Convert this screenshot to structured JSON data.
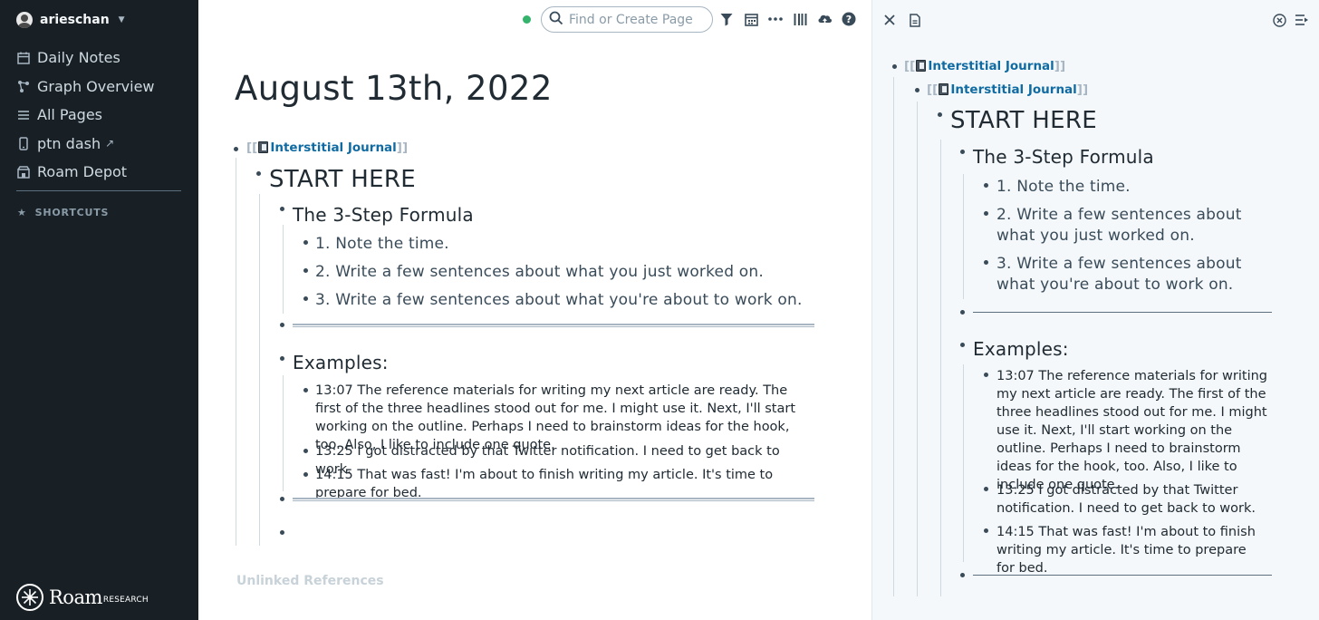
{
  "sidebar": {
    "user": "arieschan",
    "nav": [
      {
        "icon": "calendar-icon",
        "label": "Daily Notes"
      },
      {
        "icon": "graph-icon",
        "label": "Graph Overview"
      },
      {
        "icon": "list-icon",
        "label": "All Pages"
      },
      {
        "icon": "mobile-icon",
        "label": "ptn dash"
      },
      {
        "icon": "store-icon",
        "label": "Roam Depot"
      }
    ],
    "shortcuts_label": "SHORTCUTS",
    "logo_word": "Roam",
    "logo_sub": "RESEARCH"
  },
  "topbar": {
    "search_placeholder": "Find or Create Page",
    "icons": [
      "filter-icon",
      "calendar-icon",
      "more-icon",
      "sidebar-toggle-icon",
      "sync-cloud-icon",
      "help-icon"
    ]
  },
  "page": {
    "title": "August 13th, 2022",
    "ref_open": "[[",
    "ref_label": "Interstitial Journal",
    "ref_close": "]]",
    "start_here": "START HERE",
    "formula_heading": "The 3-Step Formula",
    "steps": [
      "1. Note the time.",
      "2. Write a few sentences about what you just worked on.",
      "3. Write a few sentences about what you're about to work on."
    ],
    "examples_heading": "Examples:",
    "examples": [
      "13:07 The reference materials for writing my next article are ready. The first of the three headlines stood out for me. I might use it. Next, I'll start working on the outline. Perhaps I need to brainstorm ideas for the hook, too. Also, I like to include one quote.",
      "13:25 I got distracted by that Twitter notification. I need to get back to work.",
      "14:15 That was fast! I'm about to finish writing my article. It's time to prepare for bed."
    ],
    "unlinked_refs": "Unlinked References"
  },
  "right_panel": {
    "icons": [
      "close-icon",
      "page-icon",
      "close-all-icon",
      "collapse-panel-icon"
    ],
    "ref_open": "[[",
    "ref_label": "Interstitial Journal",
    "ref_close": "]]",
    "start_here": "START HERE",
    "formula_heading": "The 3-Step Formula",
    "steps": [
      "1. Note the time.",
      "2. Write a few sentences about what you just worked on.",
      "3. Write a few sentences about what you're about to work on."
    ],
    "examples_heading": "Examples:",
    "examples": [
      "13:07 The reference materials for writing my next article are ready. The first of the three headlines stood out for me. I might use it. Next, I'll start working on the outline. Perhaps I need to brainstorm ideas for the hook, too. Also, I like to include one quote.",
      "13:25 I got distracted by that Twitter notification. I need to get back to work.",
      "14:15 That was fast! I'm about to finish writing my article. It's time to prepare for bed."
    ]
  },
  "colors": {
    "sidebar_bg": "#182026",
    "link": "#106ba3",
    "sync_dot": "#33b36b",
    "panel_bg": "#f5f8fa"
  }
}
